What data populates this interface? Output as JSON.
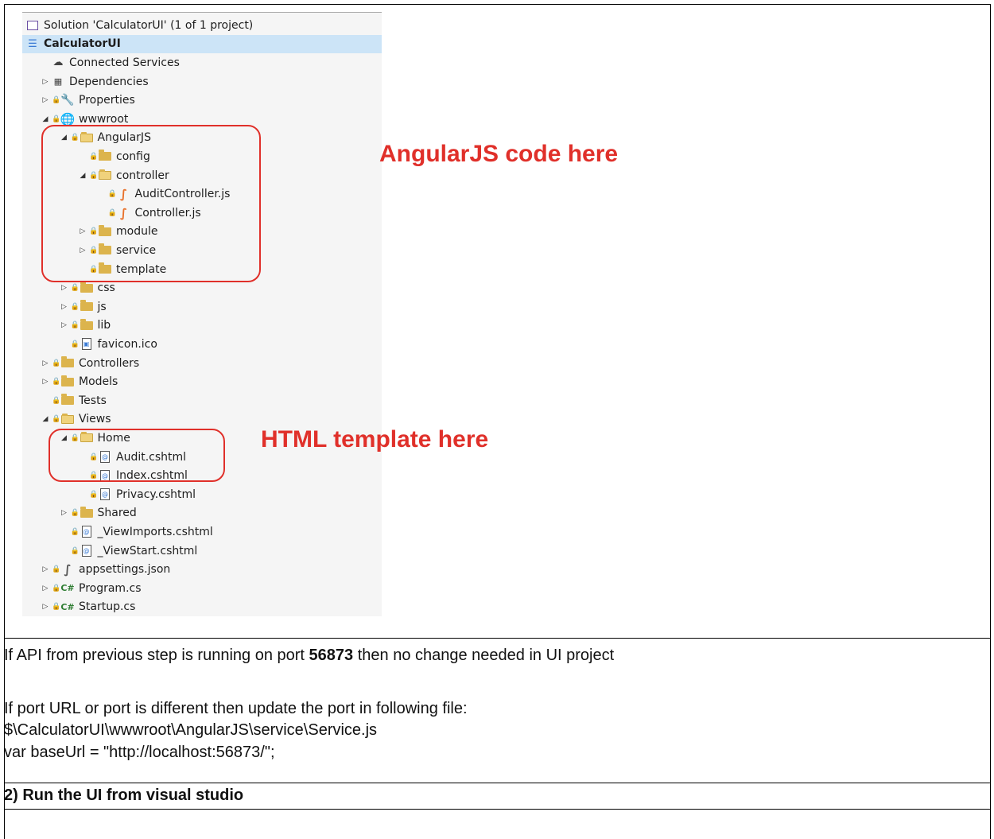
{
  "explorer": {
    "items": [
      {
        "label": "Solution 'CalculatorUI' (1 of 1 project)",
        "icon": "solution-icon",
        "expander": "",
        "lock": false,
        "level": 0
      },
      {
        "label": "CalculatorUI",
        "icon": "web-project-icon",
        "expander": "down",
        "lock": false,
        "level": 0,
        "selected": true
      },
      {
        "label": "Connected Services",
        "icon": "connected-services-icon",
        "expander": "",
        "lock": false,
        "level": 1
      },
      {
        "label": "Dependencies",
        "icon": "dependencies-icon",
        "expander": "right",
        "lock": false,
        "level": 1
      },
      {
        "label": "Properties",
        "icon": "wrench-icon",
        "expander": "right",
        "lock": true,
        "level": 1
      },
      {
        "label": "wwwroot",
        "icon": "globe-icon",
        "expander": "down",
        "lock": true,
        "level": 1
      },
      {
        "label": "AngularJS",
        "icon": "folder-open-icon",
        "expander": "down",
        "lock": true,
        "level": 2
      },
      {
        "label": "config",
        "icon": "folder-icon",
        "expander": "",
        "lock": true,
        "level": 3
      },
      {
        "label": "controller",
        "icon": "folder-open-icon",
        "expander": "down",
        "lock": true,
        "level": 3
      },
      {
        "label": "AuditController.js",
        "icon": "js-file-icon",
        "expander": "",
        "lock": true,
        "level": 4
      },
      {
        "label": "Controller.js",
        "icon": "js-file-icon",
        "expander": "",
        "lock": true,
        "level": 4
      },
      {
        "label": "module",
        "icon": "folder-icon",
        "expander": "right",
        "lock": true,
        "level": 3
      },
      {
        "label": "service",
        "icon": "folder-icon",
        "expander": "right",
        "lock": true,
        "level": 3
      },
      {
        "label": "template",
        "icon": "folder-icon",
        "expander": "",
        "lock": true,
        "level": 3
      },
      {
        "label": "css",
        "icon": "folder-icon",
        "expander": "right",
        "lock": true,
        "level": 2
      },
      {
        "label": "js",
        "icon": "folder-icon",
        "expander": "right",
        "lock": true,
        "level": 2
      },
      {
        "label": "lib",
        "icon": "folder-icon",
        "expander": "right",
        "lock": true,
        "level": 2
      },
      {
        "label": "favicon.ico",
        "icon": "image-file-icon",
        "expander": "",
        "lock": true,
        "level": 2
      },
      {
        "label": "Controllers",
        "icon": "folder-icon",
        "expander": "right",
        "lock": true,
        "level": 1
      },
      {
        "label": "Models",
        "icon": "folder-icon",
        "expander": "right",
        "lock": true,
        "level": 1
      },
      {
        "label": "Tests",
        "icon": "folder-icon",
        "expander": "",
        "lock": true,
        "level": 1
      },
      {
        "label": "Views",
        "icon": "folder-open-icon",
        "expander": "down",
        "lock": true,
        "level": 1
      },
      {
        "label": "Home",
        "icon": "folder-open-icon",
        "expander": "down",
        "lock": true,
        "level": 2
      },
      {
        "label": "Audit.cshtml",
        "icon": "razor-file-icon",
        "expander": "",
        "lock": true,
        "level": 3
      },
      {
        "label": "Index.cshtml",
        "icon": "razor-file-icon",
        "expander": "",
        "lock": true,
        "level": 3
      },
      {
        "label": "Privacy.cshtml",
        "icon": "razor-file-icon",
        "expander": "",
        "lock": true,
        "level": 3
      },
      {
        "label": "Shared",
        "icon": "folder-icon",
        "expander": "right",
        "lock": true,
        "level": 2
      },
      {
        "label": "_ViewImports.cshtml",
        "icon": "razor-file-icon",
        "expander": "",
        "lock": true,
        "level": 2
      },
      {
        "label": "_ViewStart.cshtml",
        "icon": "razor-file-icon",
        "expander": "",
        "lock": true,
        "level": 2
      },
      {
        "label": "appsettings.json",
        "icon": "json-file-icon",
        "expander": "right",
        "lock": true,
        "level": 1
      },
      {
        "label": "Program.cs",
        "icon": "csharp-file-icon",
        "expander": "right",
        "lock": true,
        "level": 1
      },
      {
        "label": "Startup.cs",
        "icon": "csharp-file-icon",
        "expander": "right",
        "lock": true,
        "level": 1
      }
    ]
  },
  "annotations": {
    "angular": "AngularJS code here",
    "html": "HTML template here"
  },
  "doc": {
    "line1_pre": "If API from previous step is running on port ",
    "line1_port": "56873",
    "line1_post": " then no change needed in UI project",
    "line2": "If port URL or port is different then update the port in following file:",
    "line3": "$\\CalculatorUI\\wwwroot\\AngularJS\\service\\Service.js",
    "line4": "var baseUrl = \"http://localhost:56873/\";",
    "step2": "2) Run the UI from visual studio"
  },
  "colors": {
    "annotation": "#e0302a",
    "selection": "#cce4f7",
    "folder": "#dcb44d"
  }
}
